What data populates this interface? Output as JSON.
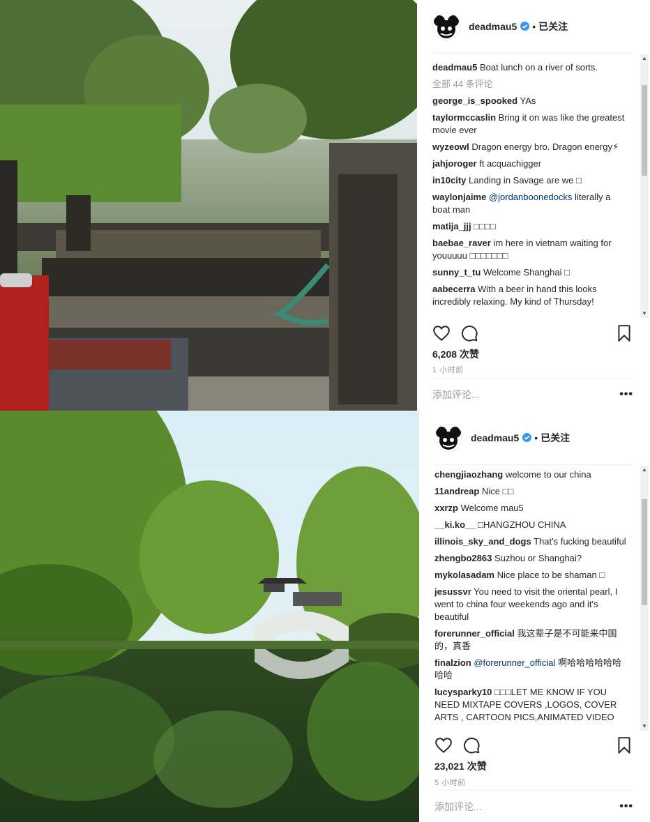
{
  "posts": [
    {
      "photo_alt": "boat on river",
      "user": "deadmau5",
      "separator": "•",
      "follow_label": "已关注",
      "caption_user": "deadmau5",
      "caption": "Boat lunch on a river of sorts.",
      "all_comments": "全部 44 条评论",
      "comments": [
        {
          "user": "george_is_spooked",
          "text": "YAs"
        },
        {
          "user": "taylormccaslin",
          "text": "Bring it on was like the greatest movie ever"
        },
        {
          "user": "wyzeowl",
          "text": "Dragon energy bro. Dragon energy⚡"
        },
        {
          "user": "jahjoroger",
          "text": "ft acquachigger"
        },
        {
          "user": "in10city",
          "text": "Landing in Savage are we □"
        },
        {
          "user": "waylonjaime",
          "mention": "@jordanboonedocks",
          "text": "literally a boat man"
        },
        {
          "user": "matija_jjj",
          "text": "□□□□"
        },
        {
          "user": "baebae_raver",
          "text": "im here in vietnam waiting for youuuuu □□□□□□□"
        },
        {
          "user": "sunny_t_tu",
          "text": "Welcome Shanghai □"
        },
        {
          "user": "aabecerra",
          "text": "With a beer in hand this looks incredibly relaxing. My kind of Thursday!"
        }
      ],
      "likes": "6,208 次赞",
      "time_ago": "1 小时前",
      "add_comment_placeholder": "添加评论...",
      "more_label": "•••"
    },
    {
      "photo_alt": "bridge and willows",
      "user": "deadmau5",
      "separator": "•",
      "follow_label": "已关注",
      "comments": [
        {
          "user": "chengjiaozhang",
          "text": "welcome to our china"
        },
        {
          "user": "11andreap",
          "text": "Nice □□"
        },
        {
          "user": "xxrzp",
          "text": "Welcome mau5"
        },
        {
          "user": "__ki.ko__",
          "text": "□HANGZHOU CHINA"
        },
        {
          "user": "illinois_sky_and_dogs",
          "text": "That's fucking beautiful"
        },
        {
          "user": "zhengbo2863",
          "text": "Suzhou or Shanghai?"
        },
        {
          "user": "mykolasadam",
          "text": "Nice place to be shaman □"
        },
        {
          "user": "jesussvr",
          "text": "You need to visit the oriental pearl, I went to china four weekends ago and it's beautiful"
        },
        {
          "user": "forerunner_official",
          "text": "我这辈子是不可能来中国的，真香"
        },
        {
          "user": "finalzion",
          "mention": "@forerunner_official",
          "text": "啊哈哈哈哈哈哈哈哈"
        },
        {
          "user": "lucysparky10",
          "text": "□□□LET ME KNOW IF YOU NEED MIXTAPE COVERS ,LOGOS, COVER ARTS , CARTOON PICS,ANIMATED VIDEO"
        }
      ],
      "likes": "23,021 次赞",
      "time_ago": "5 小时前",
      "add_comment_placeholder": "添加评论...",
      "more_label": "•••"
    }
  ],
  "colors": {
    "verified": "#3897f0",
    "link": "#003569",
    "muted": "#999999",
    "border": "#efefef"
  },
  "icons": [
    "heart-icon",
    "comment-icon",
    "bookmark-icon",
    "verified-icon",
    "more-icon"
  ]
}
